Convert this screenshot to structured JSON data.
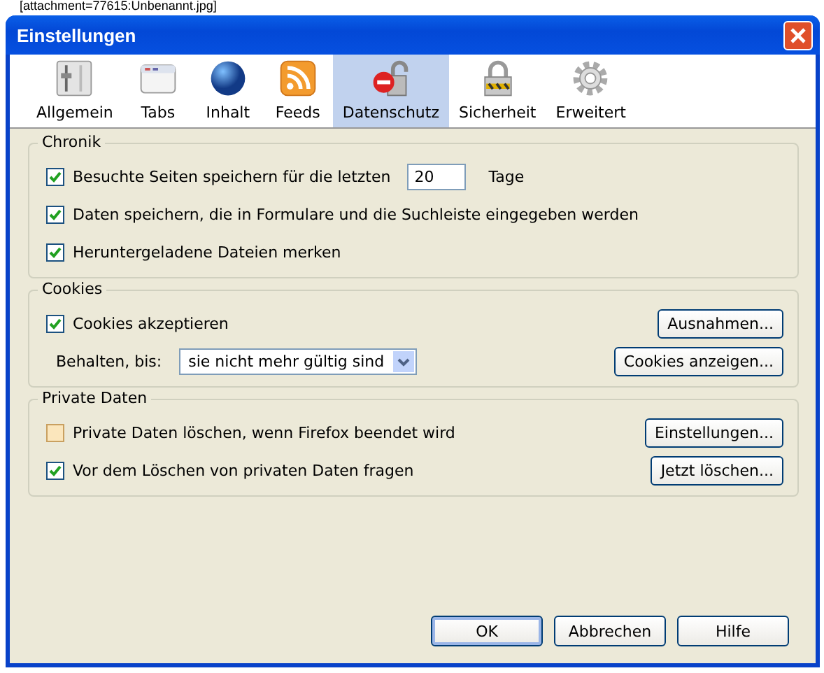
{
  "background_text": "[attachment=77615:Unbenannt.jpg]",
  "window": {
    "title": "Einstellungen"
  },
  "tabs": [
    {
      "label": "Allgemein",
      "selected": false
    },
    {
      "label": "Tabs",
      "selected": false
    },
    {
      "label": "Inhalt",
      "selected": false
    },
    {
      "label": "Feeds",
      "selected": false
    },
    {
      "label": "Datenschutz",
      "selected": true
    },
    {
      "label": "Sicherheit",
      "selected": false
    },
    {
      "label": "Erweitert",
      "selected": false
    }
  ],
  "groups": [
    {
      "title": "Chronik",
      "rows": [
        {
          "kind": "check-field",
          "label": "Besuchte Seiten speichern für die letzten",
          "checked": true,
          "value": "20",
          "suffix": "Tage"
        },
        {
          "kind": "check",
          "label": "Daten speichern, die in Formulare und die Suchleiste eingegeben werden",
          "checked": true
        },
        {
          "kind": "check",
          "label": "Heruntergeladene Dateien merken",
          "checked": true
        }
      ]
    },
    {
      "title": "Cookies",
      "rows": [
        {
          "kind": "check",
          "label": "Cookies akzeptieren",
          "checked": true,
          "button": "Ausnahmen..."
        },
        {
          "kind": "select",
          "label": "Behalten, bis:",
          "value": "sie nicht mehr gültig sind",
          "button": "Cookies anzeigen..."
        }
      ]
    },
    {
      "title": "Private Daten",
      "rows": [
        {
          "kind": "check",
          "label": "Private Daten löschen, wenn Firefox beendet wird",
          "checked": false,
          "button": "Einstellungen..."
        },
        {
          "kind": "check",
          "label": "Vor dem Löschen von privaten Daten fragen",
          "checked": true,
          "button": "Jetzt löschen..."
        }
      ]
    }
  ],
  "buttons": [
    {
      "label": "OK",
      "default": true
    },
    {
      "label": "Abbrechen",
      "default": false
    },
    {
      "label": "Hilfe",
      "default": false
    }
  ]
}
